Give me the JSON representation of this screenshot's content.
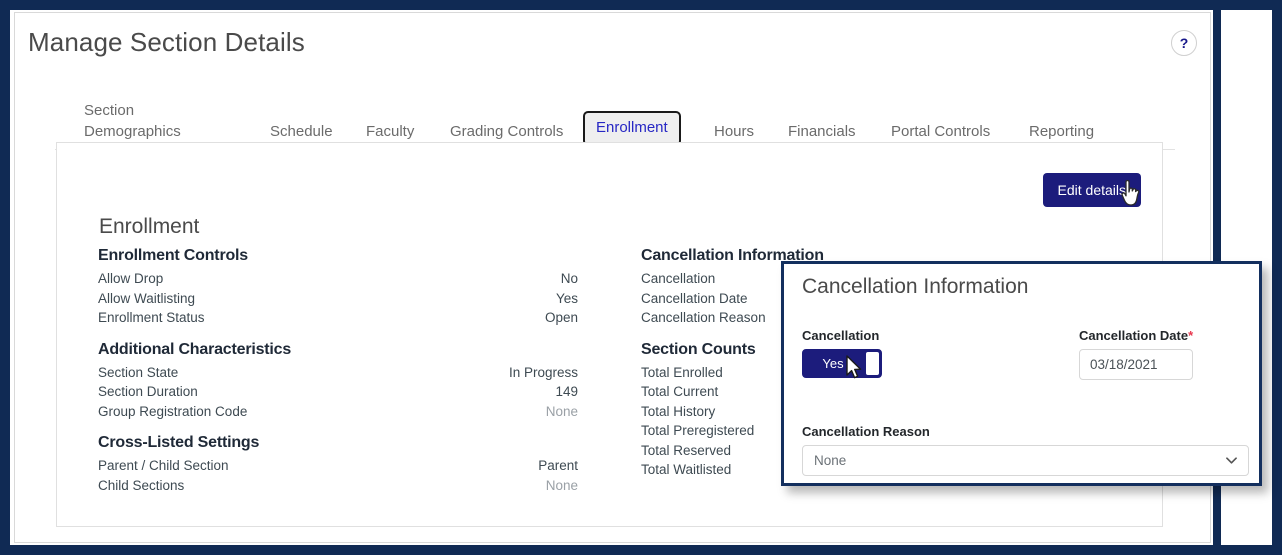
{
  "page": {
    "title": "Manage Section Details",
    "help_icon": "question-mark-icon",
    "help_label": "?"
  },
  "tabs": [
    {
      "label": "Section Demographics",
      "active": false
    },
    {
      "label": "Schedule",
      "active": false
    },
    {
      "label": "Faculty",
      "active": false
    },
    {
      "label": "Grading Controls",
      "active": false
    },
    {
      "label": "Enrollment",
      "active": true
    },
    {
      "label": "Hours",
      "active": false
    },
    {
      "label": "Financials",
      "active": false
    },
    {
      "label": "Portal Controls",
      "active": false
    },
    {
      "label": "Reporting",
      "active": false
    }
  ],
  "content": {
    "edit_button": "Edit details",
    "heading": "Enrollment",
    "left_groups": [
      {
        "title": "Enrollment Controls",
        "rows": [
          {
            "label": "Allow Drop",
            "value": "No",
            "muted": false
          },
          {
            "label": "Allow Waitlisting",
            "value": "Yes",
            "muted": false
          },
          {
            "label": "Enrollment Status",
            "value": "Open",
            "muted": false
          }
        ]
      },
      {
        "title": "Additional Characteristics",
        "rows": [
          {
            "label": "Section State",
            "value": "In Progress",
            "muted": false
          },
          {
            "label": "Section Duration",
            "value": "149",
            "muted": false
          },
          {
            "label": "Group Registration Code",
            "value": "None",
            "muted": true
          }
        ]
      },
      {
        "title": "Cross-Listed Settings",
        "rows": [
          {
            "label": "Parent / Child Section",
            "value": "Parent",
            "muted": false
          },
          {
            "label": "Child Sections",
            "value": "None",
            "muted": true
          }
        ]
      }
    ],
    "right_groups": [
      {
        "title": "Cancellation Information",
        "rows": [
          {
            "label": "Cancellation",
            "value": "",
            "muted": false
          },
          {
            "label": "Cancellation Date",
            "value": "",
            "muted": false
          },
          {
            "label": "Cancellation Reason",
            "value": "",
            "muted": false
          }
        ]
      },
      {
        "title": "Section Counts",
        "rows": [
          {
            "label": "Total Enrolled",
            "value": "",
            "muted": false
          },
          {
            "label": "Total Current",
            "value": "",
            "muted": false
          },
          {
            "label": "Total History",
            "value": "",
            "muted": false
          },
          {
            "label": "Total Preregistered",
            "value": "",
            "muted": false
          },
          {
            "label": "Total Reserved",
            "value": "",
            "muted": false
          },
          {
            "label": "Total Waitlisted",
            "value": "",
            "muted": false
          }
        ]
      }
    ]
  },
  "overlay": {
    "title": "Cancellation Information",
    "cancellation_label": "Cancellation",
    "cancellation_toggle_value": "Yes",
    "cancellation_date_label": "Cancellation Date",
    "cancellation_date_required_marker": "*",
    "cancellation_date_value": "03/18/2021",
    "cancellation_reason_label": "Cancellation Reason",
    "cancellation_reason_value": "None",
    "chevron_icon": "chevron-down-icon"
  },
  "cursors": {
    "hand": "pointing-hand-cursor",
    "arrow": "arrow-cursor"
  },
  "colors": {
    "frame_navy": "#102A54",
    "brand_navy": "#1c1c7c",
    "active_tab_text": "#2727c4",
    "required_red": "#e8384f"
  }
}
